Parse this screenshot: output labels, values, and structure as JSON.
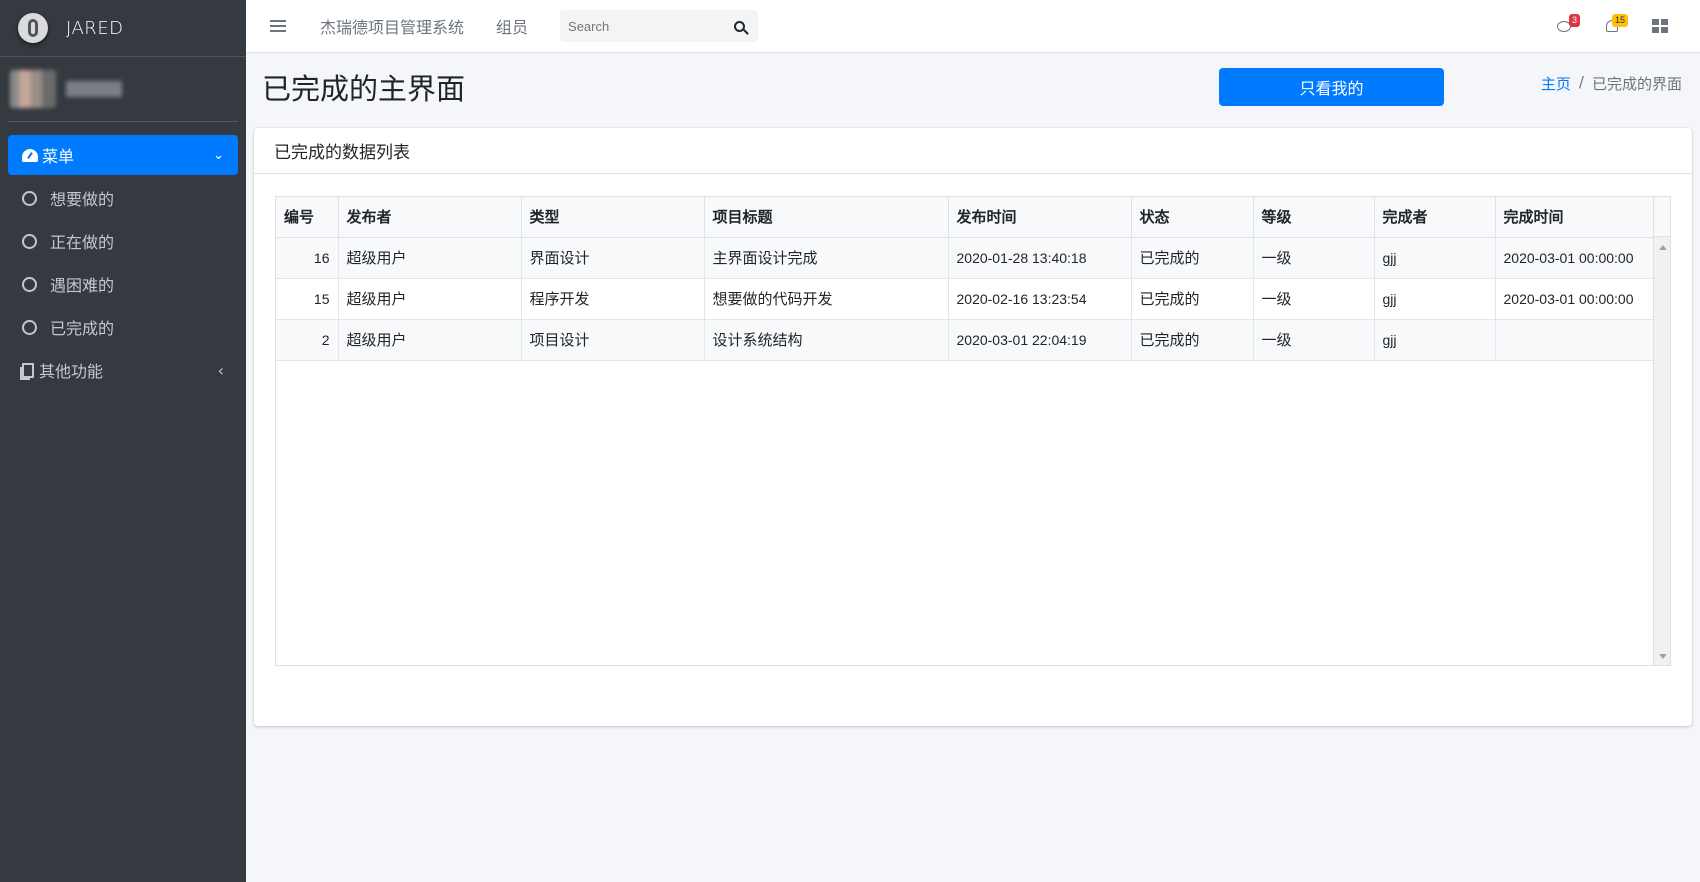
{
  "brand": {
    "name": "JARED"
  },
  "sidebar": {
    "items": [
      {
        "label": "菜单",
        "active": true
      },
      {
        "label": "想要做的"
      },
      {
        "label": "正在做的"
      },
      {
        "label": "遇困难的"
      },
      {
        "label": "已完成的"
      },
      {
        "label": "其他功能"
      }
    ]
  },
  "topbar": {
    "system_name": "杰瑞德项目管理系统",
    "members": "组员",
    "search_placeholder": "Search",
    "messages_count": "3",
    "notifications_count": "15"
  },
  "header": {
    "title": "已完成的主界面",
    "mine_button": "只看我的",
    "breadcrumb": {
      "home": "主页",
      "sep": "/",
      "current": "已完成的界面"
    }
  },
  "card": {
    "title": "已完成的数据列表",
    "columns": [
      "编号",
      "发布者",
      "类型",
      "项目标题",
      "发布时间",
      "状态",
      "等级",
      "完成者",
      "完成时间"
    ],
    "rows": [
      [
        "16",
        "超级用户",
        "界面设计",
        "主界面设计完成",
        "2020-01-28 13:40:18",
        "已完成的",
        "一级",
        "gjj",
        "2020-03-01 00:00:00"
      ],
      [
        "15",
        "超级用户",
        "程序开发",
        "想要做的代码开发",
        "2020-02-16 13:23:54",
        "已完成的",
        "一级",
        "gjj",
        "2020-03-01 00:00:00"
      ],
      [
        "2",
        "超级用户",
        "项目设计",
        "设计系统结构",
        "2020-03-01 22:04:19",
        "已完成的",
        "一级",
        "gjj",
        ""
      ]
    ]
  },
  "colors": {
    "sidebar": "#343a40",
    "primary": "#007bff",
    "badge_red": "#dc3545",
    "badge_yellow": "#ffc107"
  }
}
